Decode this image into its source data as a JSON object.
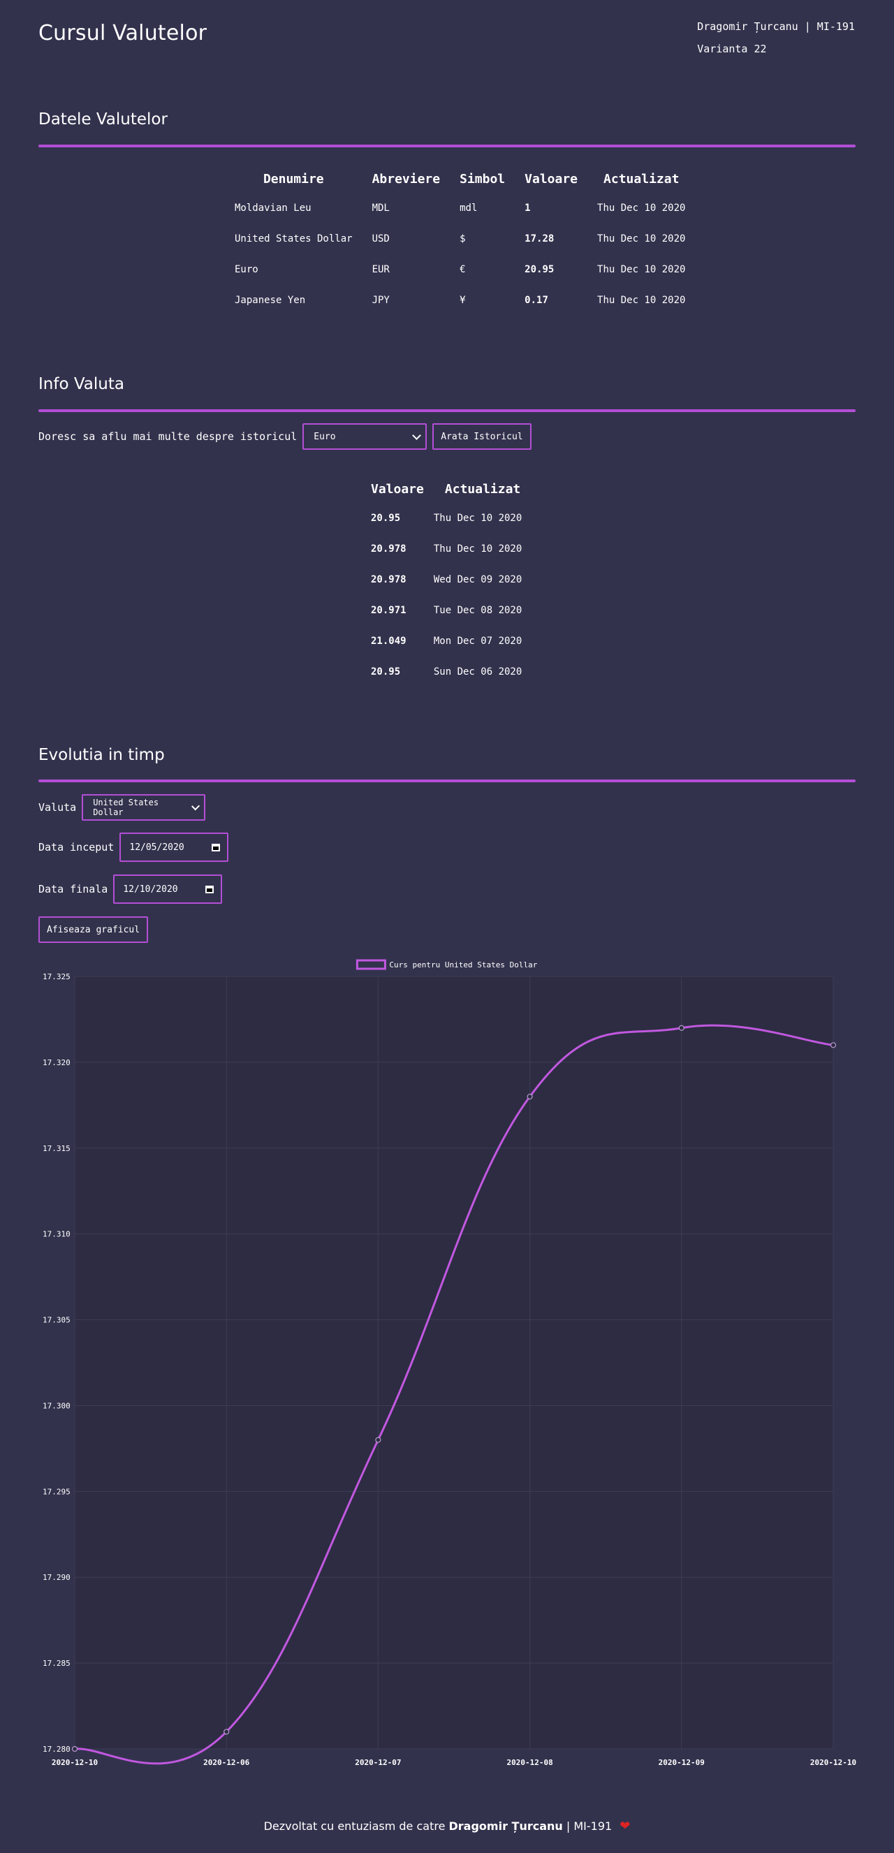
{
  "header": {
    "title": "Cursul Valutelor",
    "author": "Dragomir Țurcanu | MI-191",
    "variant": "Varianta 22"
  },
  "currency_section": {
    "title": "Datele Valutelor",
    "columns": [
      "Denumire",
      "Abreviere",
      "Simbol",
      "Valoare",
      "Actualizat"
    ],
    "rows": [
      {
        "name": "Moldavian Leu",
        "abbr": "MDL",
        "symbol": "mdl",
        "value": "1",
        "updated": "Thu Dec 10 2020"
      },
      {
        "name": "United States Dollar",
        "abbr": "USD",
        "symbol": "$",
        "value": "17.28",
        "updated": "Thu Dec 10 2020"
      },
      {
        "name": "Euro",
        "abbr": "EUR",
        "symbol": "€",
        "value": "20.95",
        "updated": "Thu Dec 10 2020"
      },
      {
        "name": "Japanese Yen",
        "abbr": "JPY",
        "symbol": "¥",
        "value": "0.17",
        "updated": "Thu Dec 10 2020"
      }
    ]
  },
  "info_section": {
    "title": "Info Valuta",
    "prompt": "Doresc sa aflu mai multe despre istoricul",
    "selected_currency": "Euro",
    "button_label": "Arata Istoricul",
    "columns": [
      "Valoare",
      "Actualizat"
    ],
    "rows": [
      {
        "value": "20.95",
        "updated": "Thu Dec 10 2020"
      },
      {
        "value": "20.978",
        "updated": "Thu Dec 10 2020"
      },
      {
        "value": "20.978",
        "updated": "Wed Dec 09 2020"
      },
      {
        "value": "20.971",
        "updated": "Tue Dec 08 2020"
      },
      {
        "value": "21.049",
        "updated": "Mon Dec 07 2020"
      },
      {
        "value": "20.95",
        "updated": "Sun Dec 06 2020"
      }
    ]
  },
  "evolution_section": {
    "title": "Evolutia in timp",
    "currency_label": "Valuta",
    "selected_currency": "United States Dollar",
    "start_label": "Data inceput",
    "start_value": "12/05/2020",
    "end_label": "Data finala",
    "end_value": "12/10/2020",
    "button_label": "Afiseaza graficul"
  },
  "chart_data": {
    "type": "line",
    "legend": "Curs pentru United States Dollar",
    "legend_position": "top-center",
    "categories": [
      "2020-12-10",
      "2020-12-06",
      "2020-12-07",
      "2020-12-08",
      "2020-12-09",
      "2020-12-10"
    ],
    "series": [
      {
        "name": "Curs pentru United States Dollar",
        "values": [
          17.28,
          17.281,
          17.298,
          17.318,
          17.322,
          17.321
        ]
      }
    ],
    "ylim": [
      17.28,
      17.325
    ],
    "yticks": [
      "17.325",
      "17.320",
      "17.315",
      "17.310",
      "17.305",
      "17.300",
      "17.295",
      "17.290",
      "17.285",
      "17.280"
    ],
    "grid": true,
    "line_color": "#c158e0"
  },
  "footer": {
    "prefix": "Dezvoltat cu entuziasm de catre",
    "author": "Dragomir Țurcanu",
    "suffix": "| MI-191",
    "heart": "❤"
  }
}
